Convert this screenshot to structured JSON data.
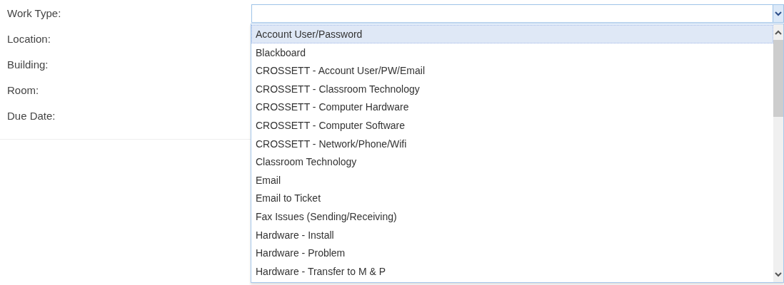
{
  "fields": [
    {
      "label": "Work Type:"
    },
    {
      "label": "Location:"
    },
    {
      "label": "Building:"
    },
    {
      "label": "Room:"
    },
    {
      "label": "Due Date:"
    }
  ],
  "combo": {
    "expanded": true
  },
  "options": [
    {
      "label": "Account User/Password",
      "selected": true
    },
    {
      "label": "Blackboard",
      "selected": false
    },
    {
      "label": "CROSSETT - Account User/PW/Email",
      "selected": false
    },
    {
      "label": "CROSSETT - Classroom Technology",
      "selected": false
    },
    {
      "label": "CROSSETT - Computer Hardware",
      "selected": false
    },
    {
      "label": "CROSSETT - Computer Software",
      "selected": false
    },
    {
      "label": "CROSSETT - Network/Phone/Wifi",
      "selected": false
    },
    {
      "label": "Classroom Technology",
      "selected": false
    },
    {
      "label": "Email",
      "selected": false
    },
    {
      "label": "Email to Ticket",
      "selected": false
    },
    {
      "label": "Fax Issues (Sending/Receiving)",
      "selected": false
    },
    {
      "label": "Hardware - Install",
      "selected": false
    },
    {
      "label": "Hardware - Problem",
      "selected": false
    },
    {
      "label": "Hardware - Transfer to M & P",
      "selected": false
    }
  ]
}
